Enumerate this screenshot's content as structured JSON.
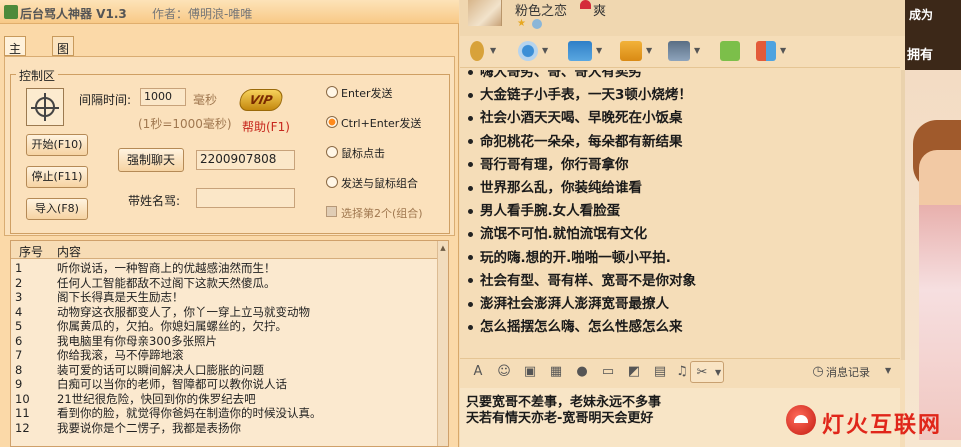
{
  "tool": {
    "title": "后台骂人神器 V1.3",
    "author": "作者：傅明浪-唯唯",
    "tabs": [
      "主界面",
      "图片设置"
    ],
    "group_label": "控制区",
    "interval_label": "间隔时间:",
    "interval_value": "1000",
    "interval_unit": "毫秒",
    "interval_hint": "(1秒=1000毫秒)",
    "vip_label": "VIP",
    "help_label": "帮助(F1)",
    "start_button": "开始(F10)",
    "stop_button": "停止(F11)",
    "import_button": "导入(F8)",
    "force_chat_button": "强制聊天",
    "force_chat_value": "2200907808",
    "with_name_label": "带姓名骂:",
    "with_name_value": "",
    "radio_options": [
      "Enter发送",
      "Ctrl+Enter发送",
      "鼠标点击",
      "发送与鼠标组合"
    ],
    "radio_selected": 1,
    "checkbox_label": "选择第2个(组合)",
    "list_headers": [
      "序号",
      "内容"
    ],
    "list_rows": [
      {
        "no": "1",
        "text": "听你说话，一种智商上的优越感油然而生！"
      },
      {
        "no": "2",
        "text": "任何人工智能都敌不过阁下这款天然傻瓜。"
      },
      {
        "no": "3",
        "text": "阁下长得真是天生励志！"
      },
      {
        "no": "4",
        "text": "动物穿这衣服都变人了，你丫一穿上立马就变动物"
      },
      {
        "no": "5",
        "text": "你属黄瓜的，欠拍。你媳妇属螺丝的，欠拧。"
      },
      {
        "no": "6",
        "text": "我电脑里有你母亲300多张照片"
      },
      {
        "no": "7",
        "text": "你给我滚，马不停蹄地滚"
      },
      {
        "no": "8",
        "text": "装可爱的话可以瞬间解决人口膨胀的问题"
      },
      {
        "no": "9",
        "text": "白痴可以当你的老师，智障都可以教你说人话"
      },
      {
        "no": "10",
        "text": "21世纪很危险，快回到你的侏罗纪去吧"
      },
      {
        "no": "11",
        "text": "看到你的脸，就觉得你爸妈在制造你的时候没认真。"
      },
      {
        "no": "12",
        "text": "我要说你是个二愣子，我都是表扬你"
      }
    ]
  },
  "chat": {
    "contact_name": "粉色之恋",
    "contact_suffix": "爽",
    "ad_line1": "成为",
    "ad_line2": "拥有",
    "messages": [
      "嗨大哥劣、哥、哥大有卖劣",
      "大金链子小手表，一天3顿小烧烤！",
      "社会小酒天天喝、早晚死在小饭桌",
      "命犯桃花一朵朵，每朵都有新结果",
      "哥行哥有理，你行哥拿你",
      "世界那么乱，你装纯给谁看",
      "男人看手腕.女人看脸蛋",
      "流氓不可怕.就怕流氓有文化",
      "玩的嗨.想的开.啪啪一顿小平拍.",
      "社会有型、哥有样、宽哥不是你对象",
      "澎湃社会澎湃人澎湃宽哥最撩人",
      "怎么摇摆怎么嗨、怎么性感怎么来"
    ],
    "history_label": "消息记录",
    "input_lines": [
      "只要宽哥不差事，老妹永远不多事",
      "天若有情天亦老-宽哥明天会更好"
    ],
    "watermark": "灯火互联网"
  }
}
